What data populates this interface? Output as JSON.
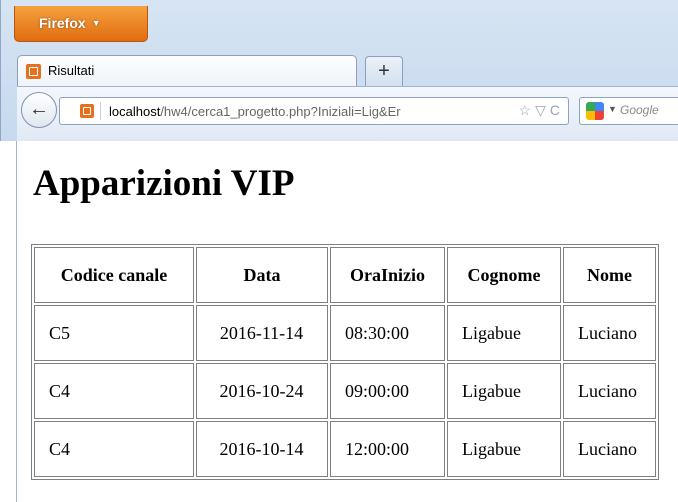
{
  "browser": {
    "menu_button_label": "Firefox",
    "tab": {
      "title": "Risultati"
    },
    "new_tab_label": "+",
    "url": {
      "host": "localhost",
      "path": "/hw4/cerca1_progetto.php?Iniziali=Lig&Er"
    },
    "search": {
      "placeholder": "Google"
    },
    "icons": [
      "firefox-menu-caret",
      "page-favicon",
      "back-arrow",
      "bookmark-star",
      "dropdown-triangle",
      "reload",
      "google-search-engine"
    ]
  },
  "page": {
    "heading": "Apparizioni VIP",
    "table": {
      "headers": [
        "Codice canale",
        "Data",
        "OraInizio",
        "Cognome",
        "Nome"
      ],
      "rows": [
        [
          "C5",
          "2016-11-14",
          "08:30:00",
          "Ligabue",
          "Luciano"
        ],
        [
          "C4",
          "2016-10-24",
          "09:00:00",
          "Ligabue",
          "Luciano"
        ],
        [
          "C4",
          "2016-10-14",
          "12:00:00",
          "Ligabue",
          "Luciano"
        ]
      ]
    }
  },
  "colors": {
    "firefox_button": "#e06d10",
    "chrome_background": "#d6e4f3"
  }
}
